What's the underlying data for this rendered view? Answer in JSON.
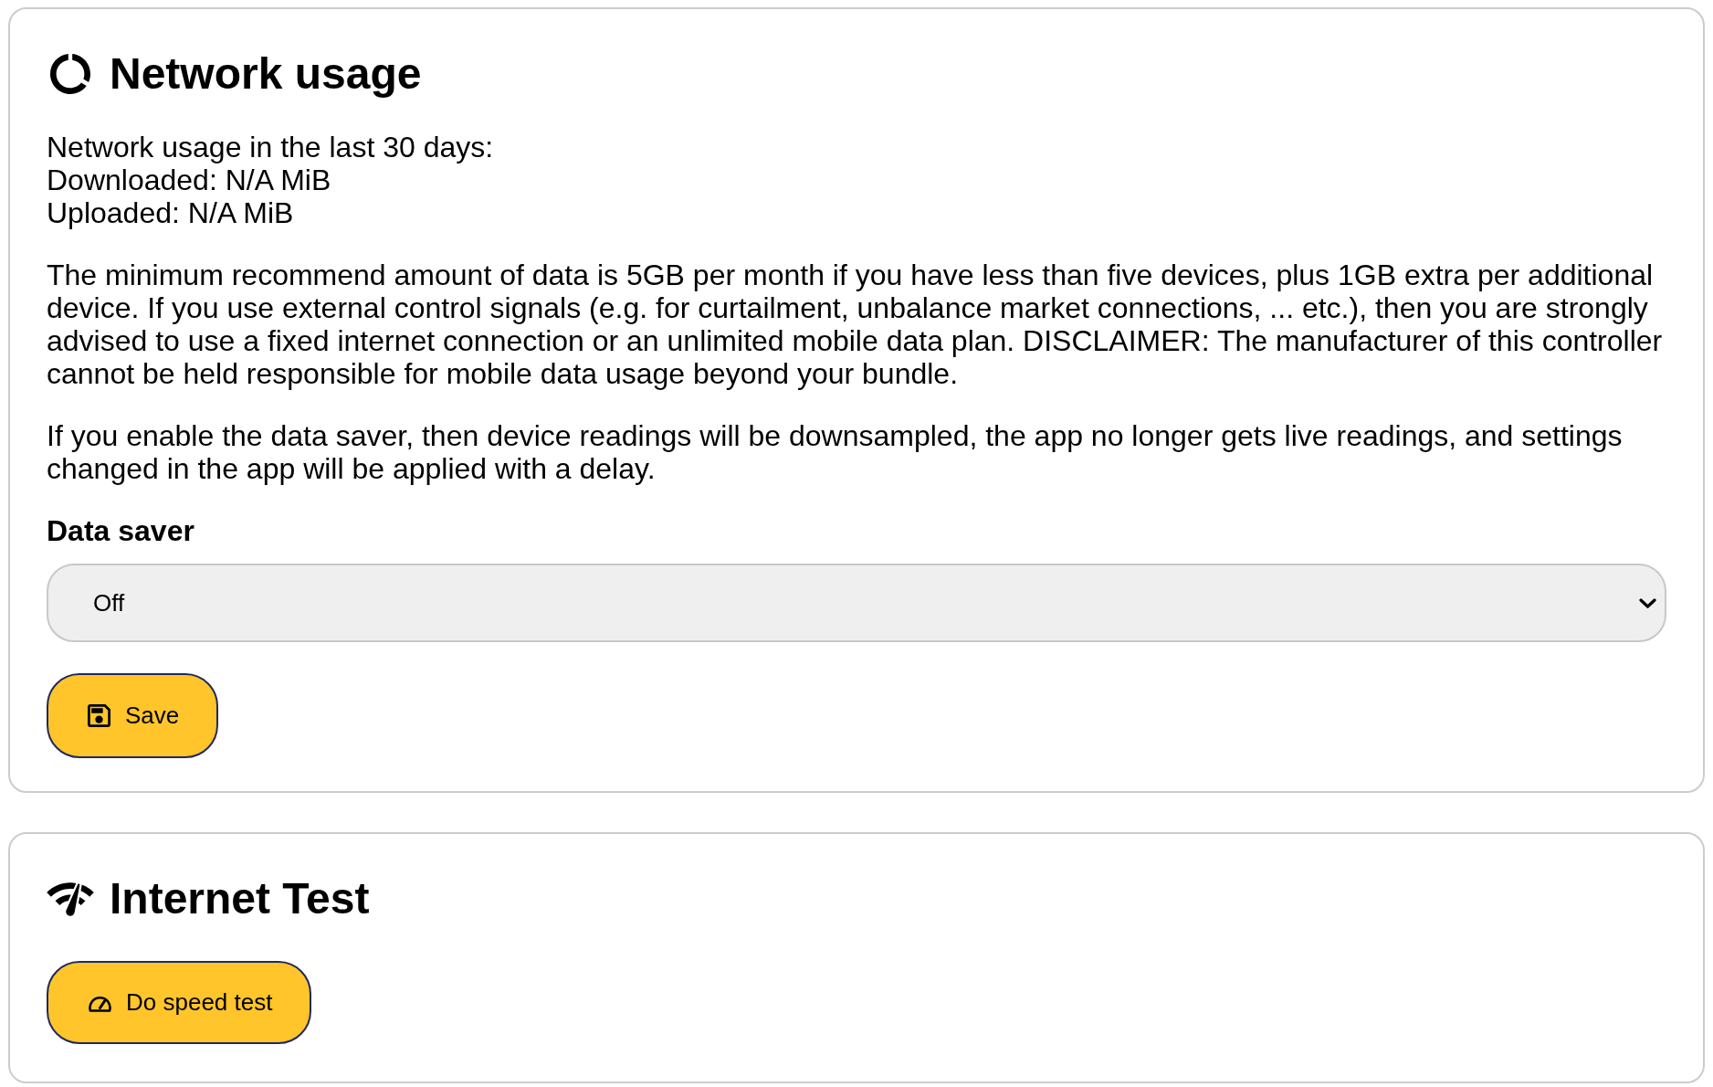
{
  "network_usage": {
    "title": "Network usage",
    "stats": [
      "Network usage in the last 30 days:",
      "Downloaded: N/A MiB",
      "Uploaded: N/A MiB"
    ],
    "paragraphs": [
      "The minimum recommend amount of data is 5GB per month if you have less than five devices, plus 1GB extra per additional device. If you use external control signals (e.g. for curtailment, unbalance market connections, ... etc.), then you are strongly advised to use a fixed internet connection or an unlimited mobile data plan. DISCLAIMER: The manufacturer of this controller cannot be held responsible for mobile data usage beyond your bundle.",
      "If you enable the data saver, then device readings will be downsampled, the app no longer gets live readings, and settings changed in the app will be applied with a delay."
    ],
    "data_saver": {
      "label": "Data saver",
      "value": "Off"
    },
    "save_button": "Save"
  },
  "internet_test": {
    "title": "Internet Test",
    "button": "Do speed test"
  }
}
